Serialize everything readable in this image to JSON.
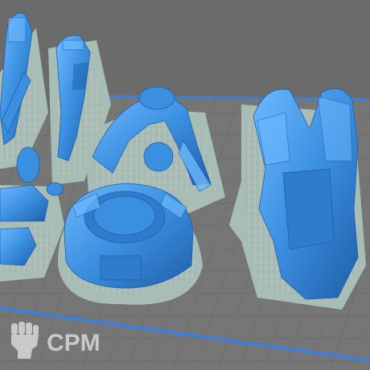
{
  "scene": {
    "description_tag": "slicer-build-plate",
    "colors": {
      "background": "#6b6b6b",
      "plate": "#7a7a7a",
      "plate_grid": "#5e5e5e",
      "plate_edge": "#3d7fd6",
      "model": "#3b8fe0",
      "model_light": "#6db8ff",
      "model_dark": "#1f5fa8",
      "supports": "#b9c4c0",
      "raft": "#a8bdb6",
      "watermark": "#d8d8d8"
    },
    "objects": [
      {
        "name": "gun-barrel-left",
        "icon": "miniature-part"
      },
      {
        "name": "gun-barrel-center",
        "icon": "miniature-part"
      },
      {
        "name": "mech-arm",
        "icon": "miniature-part"
      },
      {
        "name": "turret-base",
        "icon": "miniature-part"
      },
      {
        "name": "hull-right",
        "icon": "miniature-part"
      },
      {
        "name": "small-parts-left",
        "icon": "miniature-part"
      }
    ]
  },
  "watermark": {
    "text": "CPM",
    "icon": "raised-fist-icon"
  }
}
